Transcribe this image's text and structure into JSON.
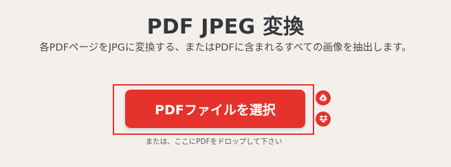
{
  "header": {
    "title": "PDF JPEG 変換",
    "subtitle": "各PDFページをJPGに変換する、またはPDFに含まれるすべての画像を抽出します。"
  },
  "upload": {
    "select_button_label": "PDFファイルを選択",
    "drop_hint": "または、ここにPDFをドロップして下さい",
    "cloud_buttons": [
      {
        "icon": "google-drive-icon"
      },
      {
        "icon": "dropbox-icon"
      }
    ]
  },
  "colors": {
    "accent": "#e5322d",
    "background": "#f3f0ec",
    "text": "#383e45"
  }
}
